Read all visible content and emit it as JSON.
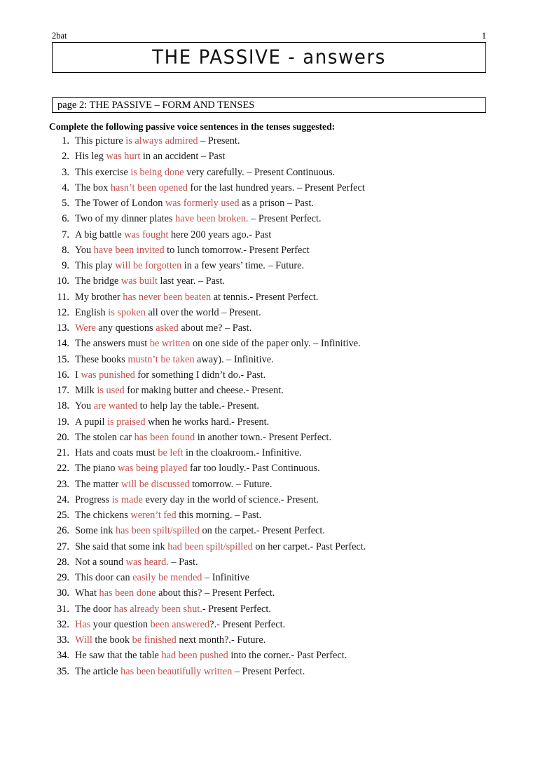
{
  "header": {
    "doc_tag": "2bat",
    "page_number": "1"
  },
  "title": {
    "text": "THE PASSIVE - answers"
  },
  "section": {
    "heading": "page 2: THE PASSIVE – FORM AND TENSES"
  },
  "instruction": {
    "text": "Complete the following passive voice sentences in the tenses suggested:"
  },
  "colors": {
    "answer_red": "#C0504D",
    "body_black": "#1a1a1a",
    "border": "#000000",
    "page_background": "#ffffff"
  },
  "answers": [
    {
      "number": "1.",
      "plain": "This picture is always admired – Present.",
      "segments": [
        {
          "text": "This picture ",
          "style": "black"
        },
        {
          "text": "is always admired",
          "style": "red"
        },
        {
          "text": " – Present.",
          "style": "black"
        }
      ]
    },
    {
      "number": "2.",
      "plain": "His leg was hurt in an accident – Past",
      "segments": [
        {
          "text": "His leg ",
          "style": "black"
        },
        {
          "text": "was hurt",
          "style": "red"
        },
        {
          "text": " in an accident – Past",
          "style": "black"
        }
      ]
    },
    {
      "number": "3.",
      "plain": "This exercise is being done very carefully. – Present Continuous.",
      "segments": [
        {
          "text": "This exercise ",
          "style": "black"
        },
        {
          "text": "is being done",
          "style": "red"
        },
        {
          "text": " very carefully. – Present Continuous.",
          "style": "black"
        }
      ]
    },
    {
      "number": "4.",
      "plain": "The box hasn’t been opened for the last hundred years. – Present Perfect",
      "segments": [
        {
          "text": "The box ",
          "style": "black"
        },
        {
          "text": "hasn’t been opened",
          "style": "red"
        },
        {
          "text": " for the last hundred years. – Present Perfect",
          "style": "black"
        }
      ]
    },
    {
      "number": "5.",
      "plain": "The Tower of London was formerly used as a prison – Past.",
      "segments": [
        {
          "text": "The Tower of London ",
          "style": "black"
        },
        {
          "text": "was formerly used",
          "style": "red"
        },
        {
          "text": " as a prison – Past.",
          "style": "black"
        }
      ]
    },
    {
      "number": "6.",
      "plain": "Two of my dinner plates have been broken. – Present Perfect.",
      "segments": [
        {
          "text": "Two of my dinner plates ",
          "style": "black"
        },
        {
          "text": "have been broken.",
          "style": "red"
        },
        {
          "text": " – Present Perfect.",
          "style": "black"
        }
      ]
    },
    {
      "number": "7.",
      "plain": "A big battle was fought here 200 years ago.- Past",
      "segments": [
        {
          "text": "A big battle ",
          "style": "black"
        },
        {
          "text": "was fought",
          "style": "red"
        },
        {
          "text": " here 200 years ago.- Past",
          "style": "black"
        }
      ]
    },
    {
      "number": "8.",
      "plain": "You have been invited to lunch tomorrow.- Present Perfect",
      "segments": [
        {
          "text": "You ",
          "style": "black"
        },
        {
          "text": "have been invited",
          "style": "red"
        },
        {
          "text": " to lunch tomorrow.- Present Perfect",
          "style": "black"
        }
      ]
    },
    {
      "number": "9.",
      "plain": "This play will be forgotten in a few years’ time. – Future.",
      "segments": [
        {
          "text": "This play ",
          "style": "black"
        },
        {
          "text": "will be forgotten",
          "style": "red"
        },
        {
          "text": " in a few years’ time. – Future.",
          "style": "black"
        }
      ]
    },
    {
      "number": "10.",
      "plain": "The bridge was built last year. – Past.",
      "segments": [
        {
          "text": "The bridge ",
          "style": "black"
        },
        {
          "text": "was built",
          "style": "red"
        },
        {
          "text": " last year. – Past.",
          "style": "black"
        }
      ]
    },
    {
      "number": "11.",
      "plain": "My brother has never been beaten at tennis.-  Present Perfect.",
      "segments": [
        {
          "text": "My brother ",
          "style": "black"
        },
        {
          "text": "has never been beaten",
          "style": "red"
        },
        {
          "text": " at tennis.-  Present Perfect.",
          "style": "black"
        }
      ]
    },
    {
      "number": "12.",
      "plain": "English is spoken all over the world – Present.",
      "segments": [
        {
          "text": "English ",
          "style": "black"
        },
        {
          "text": "is spoken",
          "style": "red"
        },
        {
          "text": " all over the world – Present.",
          "style": "black"
        }
      ]
    },
    {
      "number": "13.",
      "plain": "Were any questions  asked about me? – Past.",
      "segments": [
        {
          "text": "Were",
          "style": "red"
        },
        {
          "text": " any questions  ",
          "style": "black"
        },
        {
          "text": "asked",
          "style": "red"
        },
        {
          "text": " about me? – Past.",
          "style": "black"
        }
      ]
    },
    {
      "number": "14.",
      "plain": "The answers must be written on one side of the paper only. – Infinitive.",
      "segments": [
        {
          "text": "The answers must ",
          "style": "black"
        },
        {
          "text": "be written",
          "style": "red"
        },
        {
          "text": " on one side of the paper only. – Infinitive.",
          "style": "black"
        }
      ]
    },
    {
      "number": "15.",
      "plain": "These books mustn’t be taken away). – Infinitive.",
      "segments": [
        {
          "text": "These books ",
          "style": "black"
        },
        {
          "text": "mustn’t be taken",
          "style": "red"
        },
        {
          "text": " away). – Infinitive.",
          "style": "black"
        }
      ]
    },
    {
      "number": "16.",
      "plain": "I was punished for something I didn’t do.- Past.",
      "segments": [
        {
          "text": "I ",
          "style": "black"
        },
        {
          "text": "was punished",
          "style": "red"
        },
        {
          "text": " for something I didn’t do.- Past.",
          "style": "black"
        }
      ]
    },
    {
      "number": "17.",
      "plain": "Milk is used for making butter and cheese.- Present.",
      "segments": [
        {
          "text": "Milk ",
          "style": "black"
        },
        {
          "text": "is used",
          "style": "red"
        },
        {
          "text": " for making butter and cheese.- Present.",
          "style": "black"
        }
      ]
    },
    {
      "number": "18.",
      "plain": "You are wanted to help lay the table.- Present.",
      "segments": [
        {
          "text": "You ",
          "style": "black"
        },
        {
          "text": "are wanted",
          "style": "red"
        },
        {
          "text": " to help lay the table.- Present.",
          "style": "black"
        }
      ]
    },
    {
      "number": "19.",
      "plain": "A pupil is praised when he works hard.- Present.",
      "segments": [
        {
          "text": "A pupil ",
          "style": "black"
        },
        {
          "text": "is praised",
          "style": "red"
        },
        {
          "text": " when he works hard.- Present.",
          "style": "black"
        }
      ]
    },
    {
      "number": "20.",
      "plain": "The stolen car has been found in another town.- Present Perfect.",
      "segments": [
        {
          "text": "The stolen car ",
          "style": "black"
        },
        {
          "text": "has been found",
          "style": "red"
        },
        {
          "text": " in another town.- Present Perfect.",
          "style": "black"
        }
      ]
    },
    {
      "number": "21.",
      "plain": "Hats and coats must be left in the cloakroom.- Infinitive.",
      "segments": [
        {
          "text": "Hats and coats must ",
          "style": "black"
        },
        {
          "text": "be left",
          "style": "red"
        },
        {
          "text": " in the cloakroom.- Infinitive.",
          "style": "black"
        }
      ]
    },
    {
      "number": "22.",
      "plain": "The piano was being played far too loudly.- Past Continuous.",
      "segments": [
        {
          "text": "The piano ",
          "style": "black"
        },
        {
          "text": "was being played",
          "style": "red"
        },
        {
          "text": " far too loudly.- Past Continuous.",
          "style": "black"
        }
      ]
    },
    {
      "number": "23.",
      "plain": "The matter will be discussed tomorrow. – Future.",
      "segments": [
        {
          "text": "The matter ",
          "style": "black"
        },
        {
          "text": "will be discussed",
          "style": "red"
        },
        {
          "text": " tomorrow. – Future.",
          "style": "black"
        }
      ]
    },
    {
      "number": "24.",
      "plain": "Progress is made every day in the world of science.- Present.",
      "segments": [
        {
          "text": "Progress ",
          "style": "black"
        },
        {
          "text": "is made",
          "style": "red"
        },
        {
          "text": " every day in the world of science.- Present.",
          "style": "black"
        }
      ]
    },
    {
      "number": "25.",
      "plain": "The chickens weren’t fed this morning. – Past.",
      "segments": [
        {
          "text": "The chickens ",
          "style": "black"
        },
        {
          "text": "weren’t fed",
          "style": "red"
        },
        {
          "text": " this morning. – Past.",
          "style": "black"
        }
      ]
    },
    {
      "number": "26.",
      "plain": "Some ink has been spilt/spilled on the carpet.- Present Perfect.",
      "segments": [
        {
          "text": "Some ink ",
          "style": "black"
        },
        {
          "text": "has been spilt/spilled",
          "style": "red"
        },
        {
          "text": " on the carpet.- Present Perfect.",
          "style": "black"
        }
      ]
    },
    {
      "number": "27.",
      "plain": "She said that some ink had been spilt/spilled on her carpet.- Past Perfect.",
      "segments": [
        {
          "text": "She said that some ink ",
          "style": "black"
        },
        {
          "text": "had been spilt/spilled",
          "style": "red"
        },
        {
          "text": " on her carpet.- Past Perfect.",
          "style": "black"
        }
      ]
    },
    {
      "number": "28.",
      "plain": "Not a sound was heard. – Past.",
      "segments": [
        {
          "text": "Not a sound ",
          "style": "black"
        },
        {
          "text": "was heard.",
          "style": "red"
        },
        {
          "text": " – Past.",
          "style": "black"
        }
      ]
    },
    {
      "number": "29.",
      "plain": "This door can easily be mended – Infinitive",
      "segments": [
        {
          "text": "This door can ",
          "style": "black"
        },
        {
          "text": "easily be mended",
          "style": "red"
        },
        {
          "text": " – Infinitive",
          "style": "black"
        }
      ]
    },
    {
      "number": "30.",
      "plain": "What has been done about this? – Present Perfect.",
      "segments": [
        {
          "text": "What ",
          "style": "black"
        },
        {
          "text": "has been done",
          "style": "red"
        },
        {
          "text": " about this? – Present Perfect.",
          "style": "black"
        }
      ]
    },
    {
      "number": "31.",
      "plain": "The door has already been shut.- Present Perfect.",
      "segments": [
        {
          "text": "The door ",
          "style": "black"
        },
        {
          "text": "has already been shut.",
          "style": "red"
        },
        {
          "text": "- Present Perfect.",
          "style": "black"
        }
      ]
    },
    {
      "number": "32.",
      "plain": "Has your question been answered?.- Present Perfect.",
      "segments": [
        {
          "text": "Has",
          "style": "red"
        },
        {
          "text": " your question ",
          "style": "black"
        },
        {
          "text": "been answered",
          "style": "red"
        },
        {
          "text": "?.- Present Perfect.",
          "style": "black"
        }
      ]
    },
    {
      "number": "33.",
      "plain": "Will the book be finished next month?.- Future.",
      "segments": [
        {
          "text": "Will",
          "style": "red"
        },
        {
          "text": " the book ",
          "style": "black"
        },
        {
          "text": "be finished",
          "style": "red"
        },
        {
          "text": " next month?.- Future.",
          "style": "black"
        }
      ]
    },
    {
      "number": "34.",
      "plain": "He saw that the table had been pushed into the corner.- Past Perfect.",
      "segments": [
        {
          "text": "He saw that the table ",
          "style": "black"
        },
        {
          "text": "had been pushed",
          "style": "red"
        },
        {
          "text": " into the corner.- Past Perfect.",
          "style": "black"
        }
      ]
    },
    {
      "number": "35.",
      "plain": "The article has been beautifully written – Present Perfect.",
      "segments": [
        {
          "text": "The article ",
          "style": "black"
        },
        {
          "text": "has been beautifully written",
          "style": "red"
        },
        {
          "text": " – Present Perfect.",
          "style": "black"
        }
      ]
    }
  ]
}
